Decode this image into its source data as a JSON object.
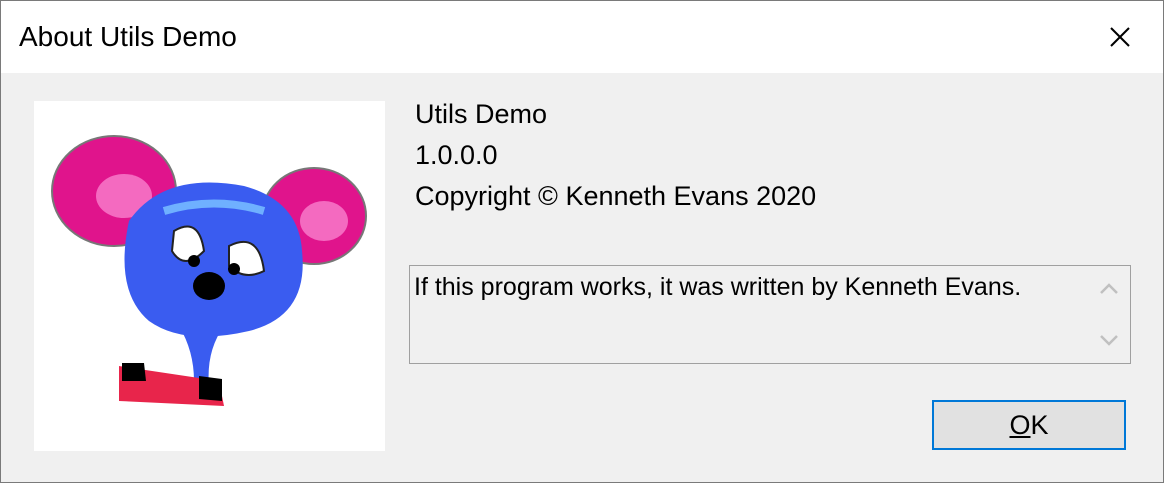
{
  "window": {
    "title": "About Utils Demo",
    "close_icon": "close-icon"
  },
  "about": {
    "product": "Utils Demo",
    "version": "1.0.0.0",
    "copyright": "Copyright © Kenneth Evans 2020",
    "description": "If this program works, it was written by Kenneth Evans."
  },
  "buttons": {
    "ok_accel": "O",
    "ok_rest": "K"
  },
  "icons": {
    "logo": "mouse-logo-icon",
    "scroll_up": "chevron-up-icon",
    "scroll_down": "chevron-down-icon"
  },
  "colors": {
    "accent": "#0078d7",
    "dialog_bg": "#f0f0f0"
  }
}
